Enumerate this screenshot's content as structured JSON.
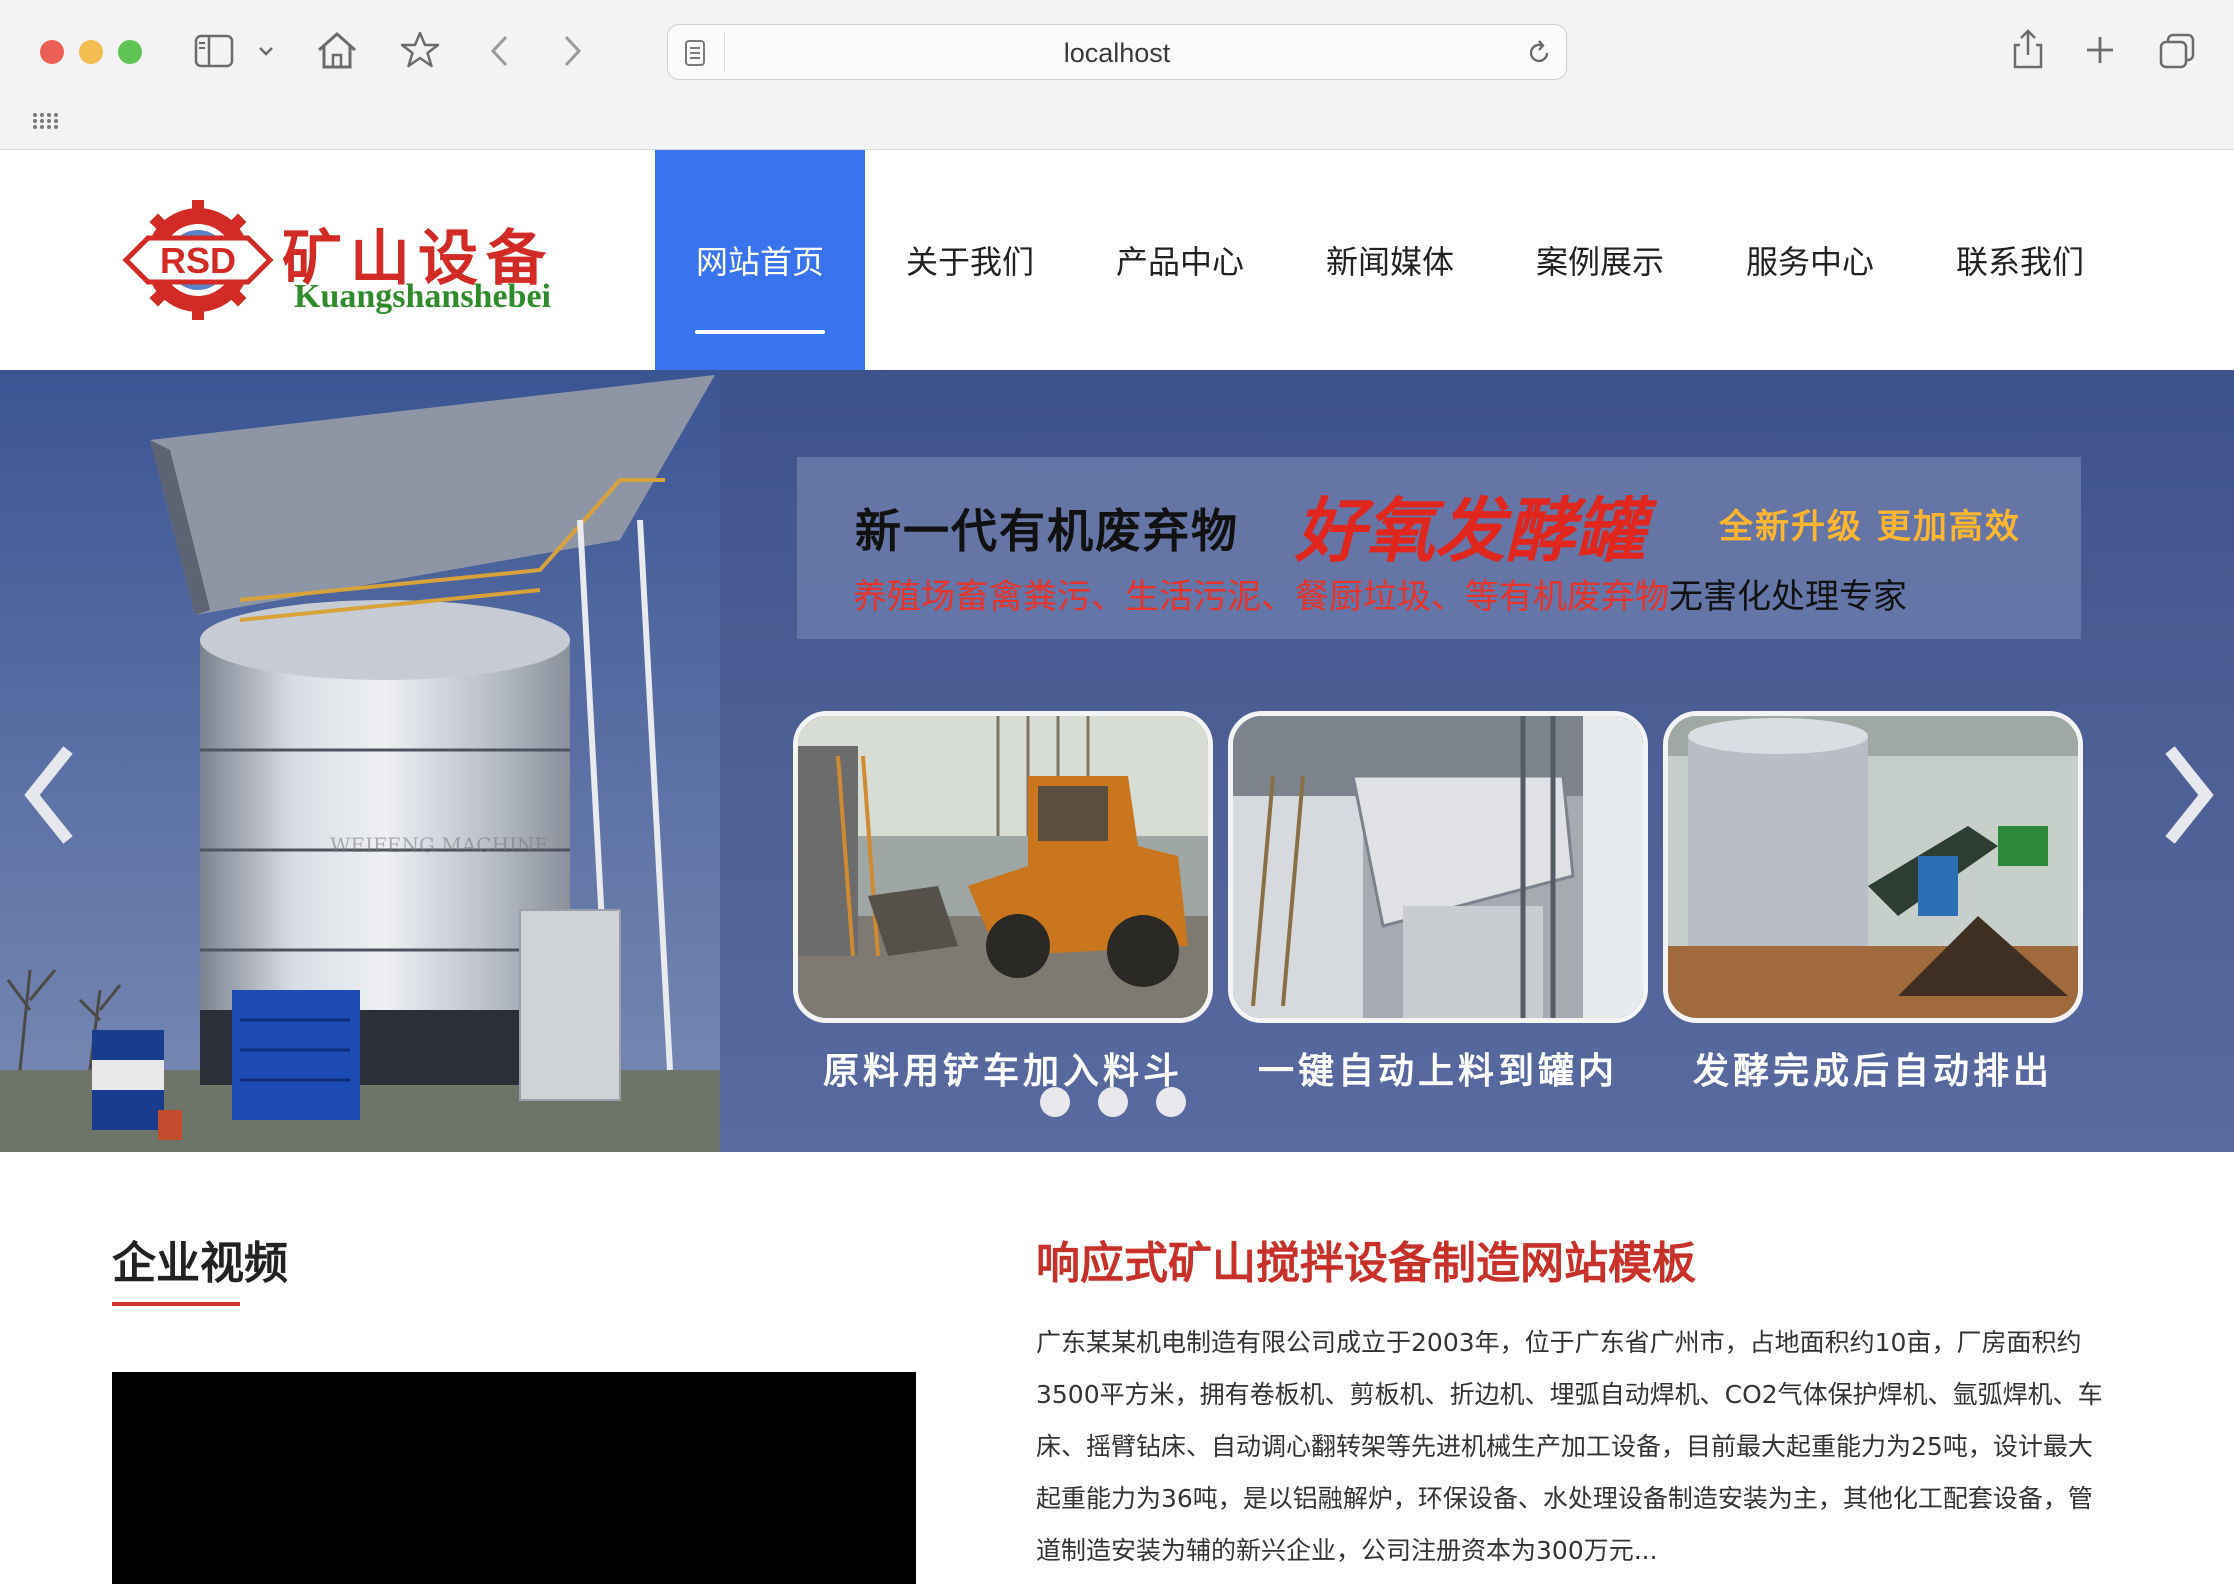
{
  "browser": {
    "url": "localhost"
  },
  "site": {
    "logo": {
      "mark": "RSD",
      "name_cn": "矿山设备",
      "name_en": "Kuangshanshebei"
    },
    "nav": [
      {
        "label": "网站首页",
        "active": true
      },
      {
        "label": "关于我们",
        "active": false
      },
      {
        "label": "产品中心",
        "active": false
      },
      {
        "label": "新闻媒体",
        "active": false
      },
      {
        "label": "案例展示",
        "active": false
      },
      {
        "label": "服务中心",
        "active": false
      },
      {
        "label": "联系我们",
        "active": false
      }
    ]
  },
  "banner": {
    "headline_a": "新一代有机废弃物",
    "headline_b": "好氧发酵罐",
    "headline_c": "全新升级  更加高效",
    "subline_red": "养殖场畜禽粪污、生活污泥、餐厨垃圾、等有机废弃物",
    "subline_dark": "无害化处理专家",
    "tank_watermark": "WEIFENG MACHINE",
    "captions": [
      "原料用铲车加入料斗",
      "一键自动上料到罐内",
      "发酵完成后自动排出"
    ],
    "slide_count": 3
  },
  "video": {
    "title": "企业视频"
  },
  "about": {
    "title": "响应式矿山搅拌设备制造网站模板",
    "text": "广东某某机电制造有限公司成立于2003年，位于广东省广州市，占地面积约10亩，厂房面积约3500平方米，拥有卷板机、剪板机、折边机、埋弧自动焊机、CO2气体保护焊机、氩弧焊机、车床、摇臂钻床、自动调心翻转架等先进机械生产加工设备，目前最大起重能力为25吨，设计最大起重能力为36吨，是以铝融解炉，环保设备、水处理设备制造安装为主，其他化工配套设备，管道制造安装为辅的新兴企业，公司注册资本为300万元..."
  },
  "colors": {
    "nav_active": "#3a73ee",
    "accent_red": "#c8302a",
    "banner_bg": "#4c5f95"
  }
}
